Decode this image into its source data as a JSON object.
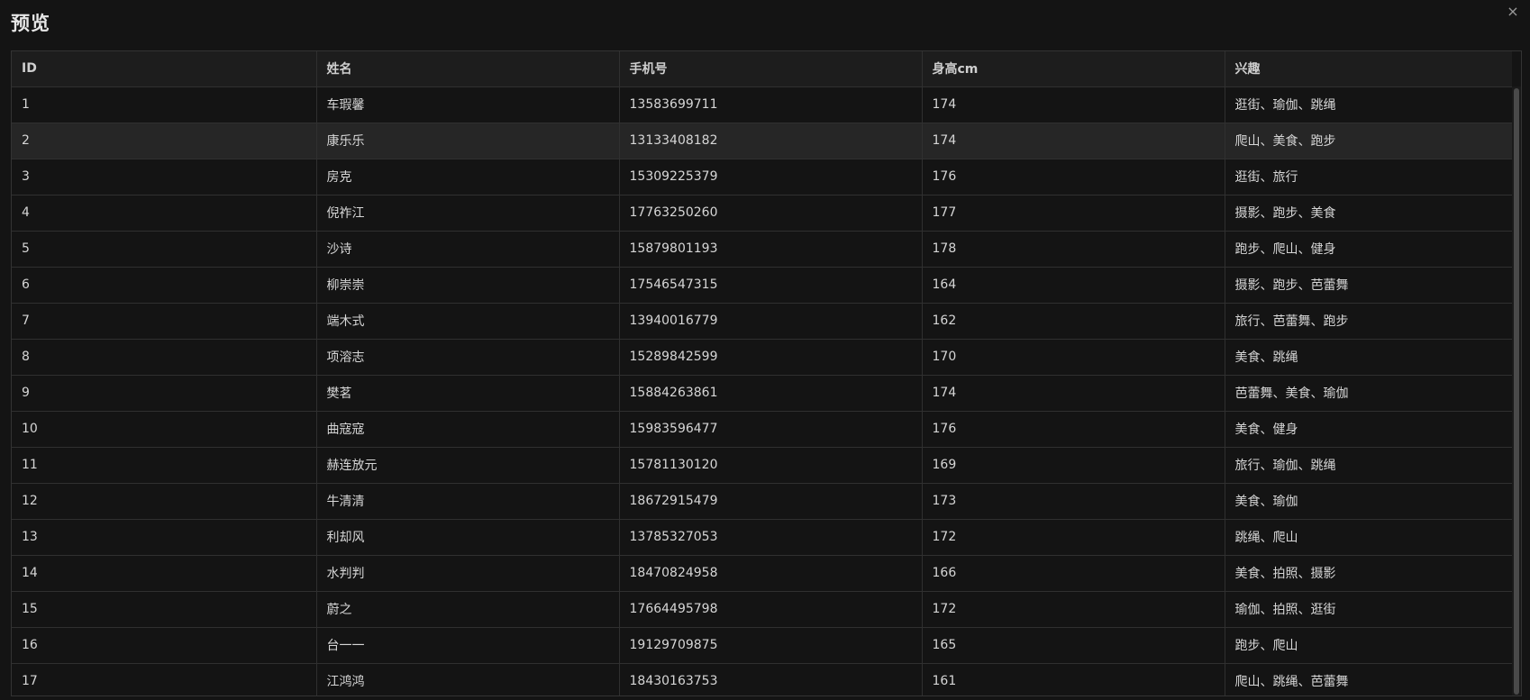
{
  "dialog": {
    "title": "预览",
    "close_icon": "×"
  },
  "table": {
    "columns": [
      "ID",
      "姓名",
      "手机号",
      "身高cm",
      "兴趣"
    ],
    "rows": [
      [
        "1",
        "车瑕馨",
        "13583699711",
        "174",
        "逛街、瑜伽、跳绳"
      ],
      [
        "2",
        "康乐乐",
        "13133408182",
        "174",
        "爬山、美食、跑步"
      ],
      [
        "3",
        "房克",
        "15309225379",
        "176",
        "逛街、旅行"
      ],
      [
        "4",
        "倪祚江",
        "17763250260",
        "177",
        "摄影、跑步、美食"
      ],
      [
        "5",
        "沙诗",
        "15879801193",
        "178",
        "跑步、爬山、健身"
      ],
      [
        "6",
        "柳崇崇",
        "17546547315",
        "164",
        "摄影、跑步、芭蕾舞"
      ],
      [
        "7",
        "端木式",
        "13940016779",
        "162",
        "旅行、芭蕾舞、跑步"
      ],
      [
        "8",
        "项溶志",
        "15289842599",
        "170",
        "美食、跳绳"
      ],
      [
        "9",
        "樊茗",
        "15884263861",
        "174",
        "芭蕾舞、美食、瑜伽"
      ],
      [
        "10",
        "曲寇寇",
        "15983596477",
        "176",
        "美食、健身"
      ],
      [
        "11",
        "赫连放元",
        "15781130120",
        "169",
        "旅行、瑜伽、跳绳"
      ],
      [
        "12",
        "牛清清",
        "18672915479",
        "173",
        "美食、瑜伽"
      ],
      [
        "13",
        "利却风",
        "13785327053",
        "172",
        "跳绳、爬山"
      ],
      [
        "14",
        "水判判",
        "18470824958",
        "166",
        "美食、拍照、摄影"
      ],
      [
        "15",
        "蔚之",
        "17664495798",
        "172",
        "瑜伽、拍照、逛街"
      ],
      [
        "16",
        "台一一",
        "19129709875",
        "165",
        "跑步、爬山"
      ],
      [
        "17",
        "江鸿鸿",
        "18430163753",
        "161",
        "爬山、跳绳、芭蕾舞"
      ]
    ],
    "hovered_row_index": 1
  },
  "colors": {
    "background": "#141414",
    "header_background": "#1d1d1d",
    "hover_row": "#262626",
    "border": "#303030"
  }
}
